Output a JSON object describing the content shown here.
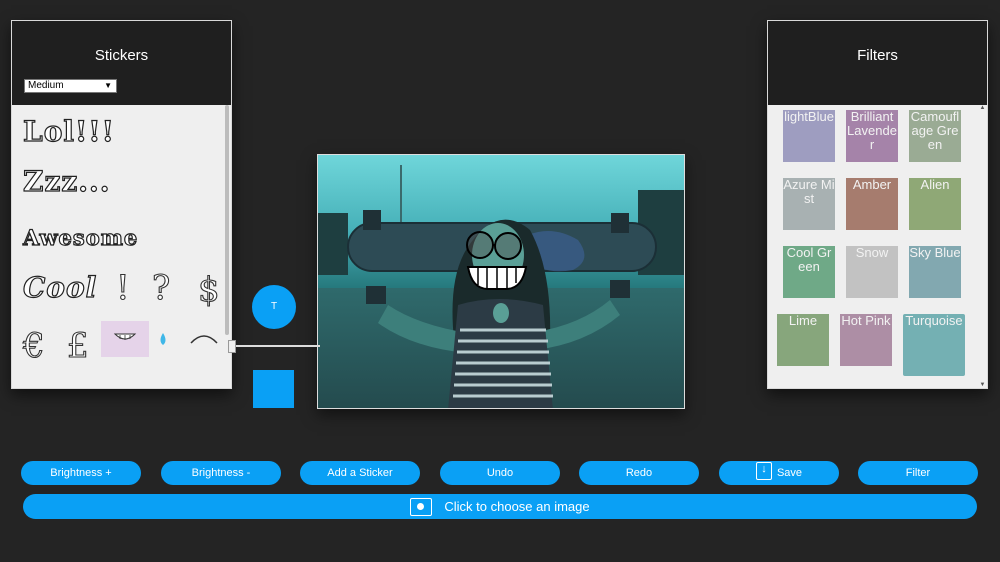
{
  "stickers": {
    "title": "Stickers",
    "size_select": "Medium",
    "words": [
      "Lol!!!",
      "Zzz...",
      "Awesome",
      "Cool"
    ],
    "symbols": [
      "!",
      "?",
      "$",
      "€",
      "£"
    ]
  },
  "filters": {
    "title": "Filters",
    "items": [
      {
        "label": "lightBlue",
        "color": "#9e9dc0"
      },
      {
        "label": "Brilliant Lavender",
        "color": "#a583a9"
      },
      {
        "label": "Camouflage Green",
        "color": "#9aab94"
      },
      {
        "label": "Azure Mist",
        "color": "#a8b1b2"
      },
      {
        "label": "Amber",
        "color": "#a67c6e"
      },
      {
        "label": "Alien",
        "color": "#8fa876"
      },
      {
        "label": "Cool Green",
        "color": "#6fa987"
      },
      {
        "label": "Snow",
        "color": "#c2c2c2"
      },
      {
        "label": "Sky Blue",
        "color": "#82a8b0"
      },
      {
        "label": "Lime",
        "color": "#87a67c"
      },
      {
        "label": "Hot Pink",
        "color": "#ad8ea5"
      },
      {
        "label": "Turquoise",
        "color": "#74b0b3"
      }
    ]
  },
  "text_tool": {
    "label": "T"
  },
  "accent_color": "#0aa0f5",
  "toolbar": {
    "brightness_up": "Brightness +",
    "brightness_down": "Brightness -",
    "add_sticker": "Add a Sticker",
    "undo": "Undo",
    "redo": "Redo",
    "save": "Save",
    "filter": "Filter"
  },
  "choose_image": "Click to choose an image"
}
